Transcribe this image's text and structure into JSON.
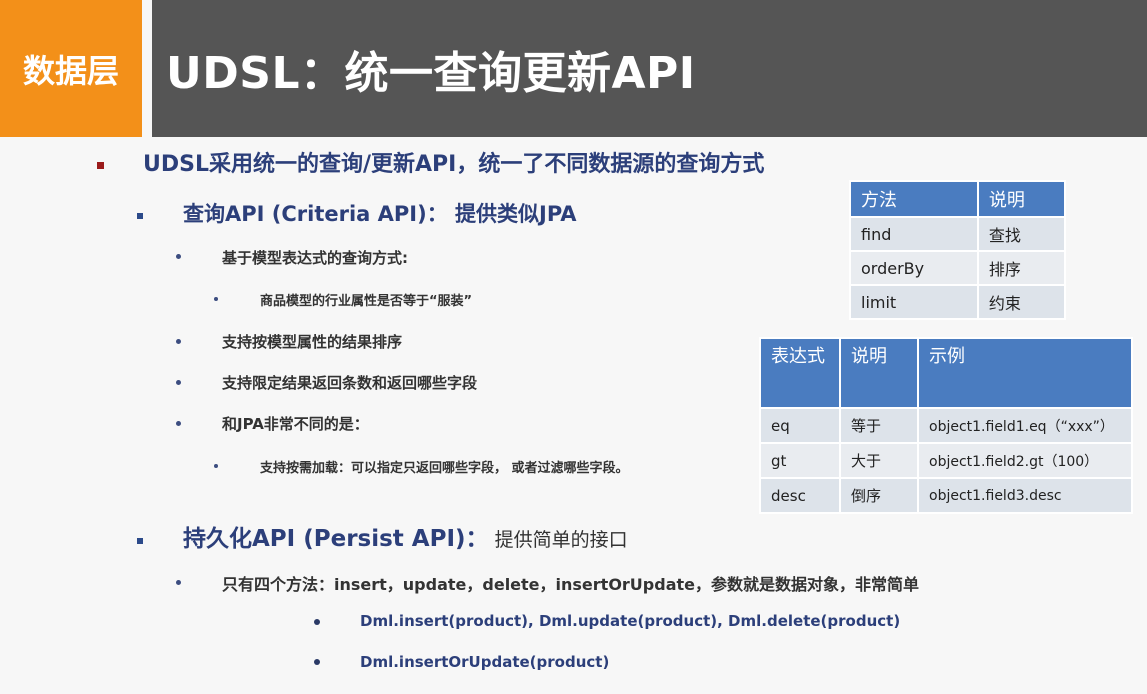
{
  "section_tag": "数据层",
  "title": "UDSL：统一查询更新API",
  "intro": "UDSL采用统一的查询/更新API，统一了不同数据源的查询方式",
  "query_api": {
    "heading": "查询API  (Criteria API)：",
    "heading_suffix": " 提供类似JPA",
    "items": [
      "基于模型表达式的查询方式:",
      "支持按模型属性的结果排序",
      "支持限定结果返回条数和返回哪些字段",
      "和JPA非常不同的是："
    ],
    "sub_item_1": "商品模型的行业属性是否等于“服装”",
    "sub_item_2": "支持按需加载：可以指定只返回哪些字段， 或者过滤哪些字段。"
  },
  "persist_api": {
    "heading": "持久化API (Persist API)：",
    "heading_suffix": " 提供简单的接口",
    "methods_text": "只有四个方法：insert，update，delete，insertOrUpdate，参数就是数据对象，非常简单",
    "examples": [
      "Dml.insert(product),   Dml.update(product),   Dml.delete(product)",
      "Dml.insertOrUpdate(product)"
    ]
  },
  "method_table": {
    "headers": [
      "方法",
      "说明"
    ],
    "rows": [
      [
        "find",
        "查找"
      ],
      [
        "orderBy",
        "排序"
      ],
      [
        "limit",
        "约束"
      ]
    ]
  },
  "expr_table": {
    "headers": [
      "表达式",
      "说明",
      "示例"
    ],
    "rows": [
      [
        "eq",
        "等于",
        "object1.field1.eq（“xxx”）"
      ],
      [
        "gt",
        "大于",
        "object1.field2.gt（100）"
      ],
      [
        "desc",
        "倒序",
        "object1.field3.desc"
      ]
    ]
  },
  "colors": {
    "tag_bg": "#f39019",
    "title_bg": "#555555",
    "table_header": "#4a7cc0",
    "heading_text": "#2c3f7a"
  }
}
